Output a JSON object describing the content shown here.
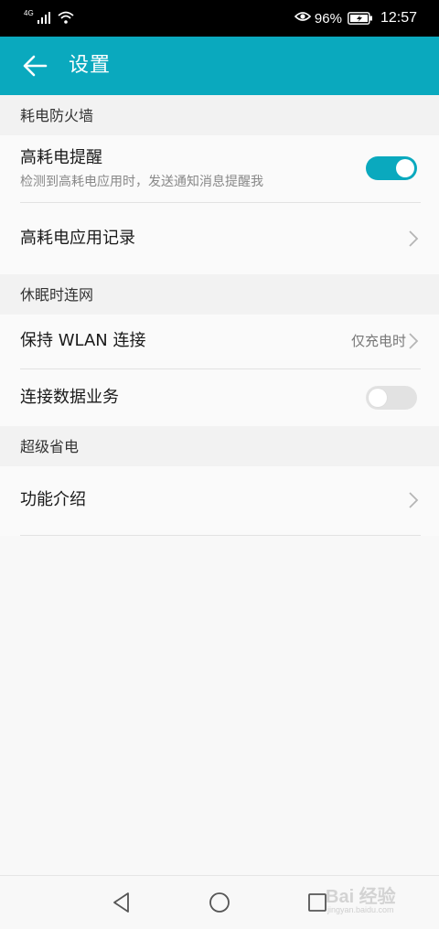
{
  "status_bar": {
    "network_label": "4G",
    "battery_percent": "96%",
    "clock": "12:57",
    "icons": [
      "signal-icon",
      "wifi-icon",
      "eye-comfort-icon",
      "battery-charging-icon"
    ]
  },
  "header": {
    "title": "设置",
    "back_icon": "arrow-left-icon",
    "background": "#0aa9be"
  },
  "sections": {
    "power_firewall": {
      "header": "耗电防火墙",
      "high_power_alert": {
        "title": "高耗电提醒",
        "subtitle": "检测到高耗电应用时，发送通知消息提醒我",
        "toggle_on": true
      },
      "high_power_records": {
        "title": "高耗电应用记录"
      }
    },
    "sleep_network": {
      "header": "休眠时连网",
      "keep_wlan": {
        "title": "保持 WLAN 连接",
        "value": "仅充电时"
      },
      "mobile_data": {
        "title": "连接数据业务",
        "toggle_on": false
      }
    },
    "super_saving": {
      "header": "超级省电",
      "feature_intro": {
        "title": "功能介绍"
      }
    }
  },
  "nav_bar": {
    "icons": [
      "back-triangle-icon",
      "home-circle-icon",
      "recents-square-icon"
    ]
  },
  "watermark": {
    "logo": "Bai 经验",
    "url": "jingyan.baidu.com"
  },
  "colors": {
    "accent": "#0aa9be",
    "toggle_off": "#e2e2e2",
    "section_bg": "#f2f2f2"
  }
}
